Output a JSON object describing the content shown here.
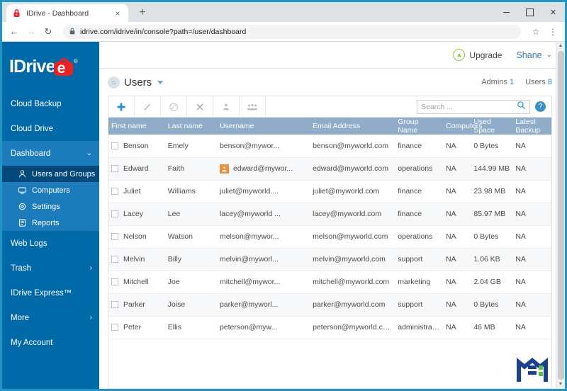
{
  "browser": {
    "tab": {
      "title": "IDrive - Dashboard",
      "favicon": "padlock-icon",
      "close": "×"
    },
    "new_tab_label": "+",
    "window_controls": {
      "minimize": "–",
      "maximize": "□",
      "close": "✕"
    },
    "nav": {
      "back": "←",
      "forward": "→",
      "reload": "↻"
    },
    "omnibox": {
      "lock": "🔒",
      "host": "idrive.com",
      "path": "/idrive/in/console?path=/user/dashboard",
      "full_url": "idrive.com/idrive/in/console?path=/user/dashboard"
    },
    "bookmark_icon": "☆",
    "menu_icon": "⋮"
  },
  "sidebar": {
    "logo": {
      "text": "IDrive",
      "lock_letter": "e",
      "registered": "®"
    },
    "items": [
      {
        "label": "Cloud Backup",
        "icon": "",
        "chevron": "",
        "expanded": false
      },
      {
        "label": "Cloud Drive",
        "icon": "",
        "chevron": "",
        "expanded": false
      },
      {
        "label": "Dashboard",
        "icon": "",
        "chevron": "⌄",
        "expanded": true
      },
      {
        "label": "Web Logs",
        "icon": "",
        "chevron": "",
        "expanded": false
      },
      {
        "label": "Trash",
        "icon": "",
        "chevron": "›",
        "expanded": false
      },
      {
        "label": "IDrive Express™",
        "icon": "",
        "chevron": "",
        "expanded": false
      },
      {
        "label": "More",
        "icon": "",
        "chevron": "›",
        "expanded": false
      },
      {
        "label": "My Account",
        "icon": "",
        "chevron": "",
        "expanded": false
      }
    ],
    "subitems": [
      {
        "label": "Users and Groups",
        "icon": "person-icon",
        "active": true
      },
      {
        "label": "Computers",
        "icon": "monitor-icon",
        "active": false
      },
      {
        "label": "Settings",
        "icon": "gear-icon",
        "active": false
      },
      {
        "label": "Reports",
        "icon": "document-icon",
        "active": false
      }
    ]
  },
  "topbar": {
    "upgrade_label": "Upgrade",
    "upgrade_icon": "up-arrow-icon",
    "user_name": "Shane",
    "user_chevron": "⌄"
  },
  "page": {
    "home_icon": "home-icon",
    "title": "Users",
    "admins_label": "Admins",
    "admins_count": "1",
    "users_label": "Users",
    "users_count": "8"
  },
  "table_toolbar": {
    "buttons": [
      {
        "name": "add-user-button",
        "icon": "plus-icon"
      },
      {
        "name": "edit-user-button",
        "icon": "pencil-icon"
      },
      {
        "name": "disable-user-button",
        "icon": "no-entry-icon"
      },
      {
        "name": "delete-user-button",
        "icon": "close-x-icon"
      },
      {
        "name": "assign-user-button",
        "icon": "user-icon"
      },
      {
        "name": "groups-button",
        "icon": "group-icon"
      }
    ],
    "search_placeholder": "Search ...",
    "search_value": "",
    "search_icon": "search-icon",
    "help_icon": "question-mark-icon"
  },
  "table": {
    "columns": [
      "First name",
      "Last name",
      "Username",
      "Email Address",
      "Group Name",
      "Computers",
      "Used Space",
      "Latest Backup"
    ],
    "rows": [
      {
        "first": "Benson",
        "last": "Emely",
        "username": "benson@mywor...",
        "email": "benson@myworld.com",
        "group": "finance",
        "computers": "NA",
        "used": "0 Bytes",
        "backup": "NA",
        "admin": false
      },
      {
        "first": "Edward",
        "last": "Faith",
        "username": "edward@mywor...",
        "email": "edward@myworld.com",
        "group": "operations",
        "computers": "NA",
        "used": "144.99 MB",
        "backup": "NA",
        "admin": true
      },
      {
        "first": "Juliet",
        "last": "Williams",
        "username": "juliet@myworld....",
        "email": "juliet@myworld.com",
        "group": "finance",
        "computers": "NA",
        "used": "23.98 MB",
        "backup": "NA",
        "admin": false
      },
      {
        "first": "Lacey",
        "last": "Lee",
        "username": "lacey@myworld ...",
        "email": "lacey@myworld.com",
        "group": "finance",
        "computers": "NA",
        "used": "85.97 MB",
        "backup": "NA",
        "admin": false
      },
      {
        "first": "Nelson",
        "last": "Watson",
        "username": "melson@mywor...",
        "email": "melson@myworld.com",
        "group": "operations",
        "computers": "NA",
        "used": "0 Bytes",
        "backup": "NA",
        "admin": false
      },
      {
        "first": "Melvin",
        "last": "Billy",
        "username": "melvin@myworl...",
        "email": "melvin@myworld.com",
        "group": "support",
        "computers": "NA",
        "used": "1.06 KB",
        "backup": "NA",
        "admin": false
      },
      {
        "first": "Mitchell",
        "last": "Joe",
        "username": "mitchell@mywor...",
        "email": "mitchell@myworld.com",
        "group": "marketing",
        "computers": "NA",
        "used": "2.04 GB",
        "backup": "NA",
        "admin": false
      },
      {
        "first": "Parker",
        "last": "Joise",
        "username": "parker@myworl...",
        "email": "parker@myworld.com",
        "group": "support",
        "computers": "NA",
        "used": "0 Bytes",
        "backup": "NA",
        "admin": false
      },
      {
        "first": "Peter",
        "last": "Ellis",
        "username": "peterson@myw...",
        "email": "peterson@myworld.com",
        "group": "administration",
        "computers": "NA",
        "used": "46 MB",
        "backup": "NA",
        "admin": false
      }
    ]
  },
  "watermark": {
    "name": "m-logo-watermark"
  },
  "colors": {
    "sidebar_bg": "#0069a8",
    "sidebar_expanded": "#1c7bbb",
    "sidebar_active": "#00497a",
    "accent_blue": "#2a7fc0",
    "table_header": "#8fadc8",
    "upgrade_green": "#8dc63f",
    "logo_red": "#ed2024",
    "admin_orange": "#f0903c",
    "window_border": "#2196c4"
  }
}
